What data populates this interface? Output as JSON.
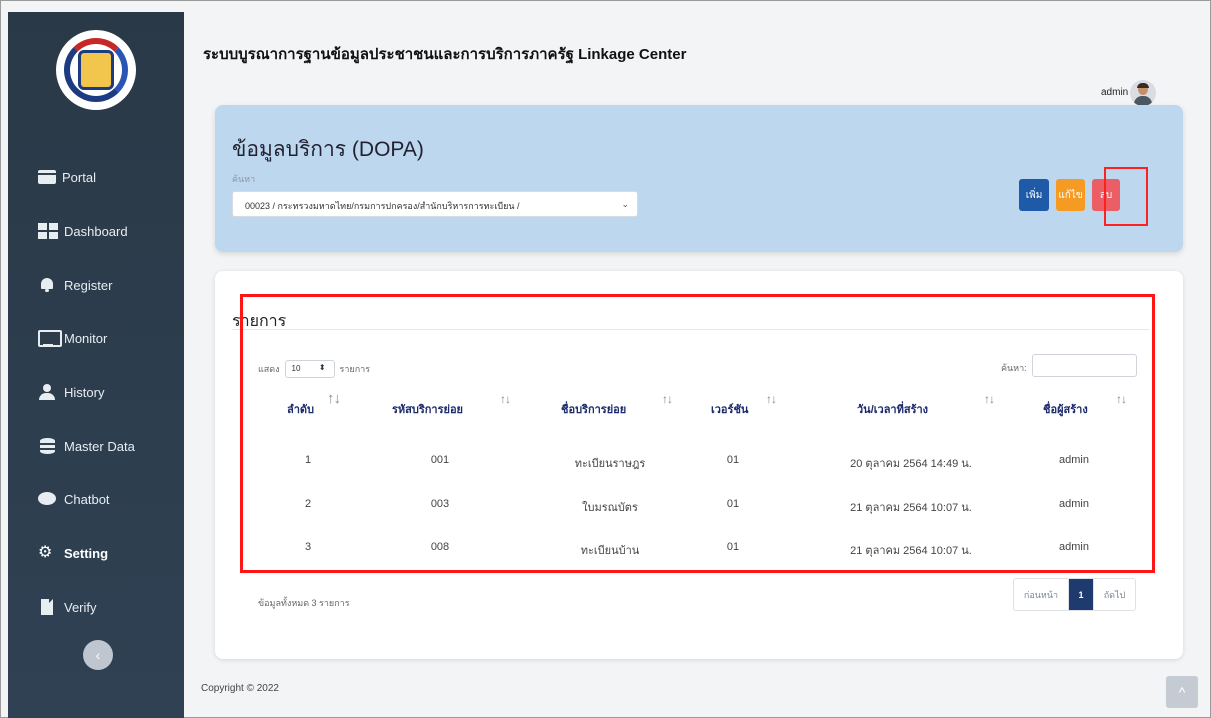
{
  "header": {
    "title": "ระบบบูรณาการฐานข้อมูลประชาชนและการบริการภาครัฐ Linkage Center",
    "user": "admin"
  },
  "sidebar": {
    "logo_text": "กรมการพัฒนาชุมชน",
    "items": [
      {
        "label": "Portal",
        "icon": "portal-icon"
      },
      {
        "label": "Dashboard",
        "icon": "dashboard-icon"
      },
      {
        "label": "Register",
        "icon": "bell-icon"
      },
      {
        "label": "Monitor",
        "icon": "monitor-icon"
      },
      {
        "label": "History",
        "icon": "user-icon"
      },
      {
        "label": "Master Data",
        "icon": "database-icon"
      },
      {
        "label": "Chatbot",
        "icon": "chat-icon"
      },
      {
        "label": "Setting",
        "icon": "gear-icon"
      },
      {
        "label": "Verify",
        "icon": "file-icon"
      }
    ],
    "collapse": "‹"
  },
  "service": {
    "title": "ข้อมูลบริการ (DOPA)",
    "search_label": "ค้นหา",
    "selected": "00023 / กระทรวงมหาดไทย/กรมการปกครอง/สำนักบริหารการทะเบียน /",
    "add": "เพิ่ม",
    "edit": "แก้ไข",
    "delete": "ลบ"
  },
  "list": {
    "title": "รายการ",
    "show_prefix": "แสดง",
    "page_length": "10",
    "show_suffix": "รายการ",
    "search_label": "ค้นหา:",
    "columns": [
      "ลำดับ",
      "รหัสบริการย่อย",
      "ชื่อบริการย่อย",
      "เวอร์ชัน",
      "วัน/เวลาที่สร้าง",
      "ชื่อผู้สร้าง"
    ],
    "rows": [
      [
        "1",
        "001",
        "ทะเบียนราษฎร",
        "01",
        "20 ตุลาคม 2564 14:49 น.",
        "admin"
      ],
      [
        "2",
        "003",
        "ใบมรณบัตร",
        "01",
        "21 ตุลาคม 2564 10:07 น.",
        "admin"
      ],
      [
        "3",
        "008",
        "ทะเบียนบ้าน",
        "01",
        "21 ตุลาคม 2564 10:07 น.",
        "admin"
      ]
    ],
    "total_info": "ข้อมูลทั้งหมด 3 รายการ",
    "pager": {
      "prev": "ก่อนหน้า",
      "current": "1",
      "next": "ถัดไป"
    }
  },
  "footer": {
    "copyright": "Copyright © 2022",
    "scroll_top": "^"
  }
}
